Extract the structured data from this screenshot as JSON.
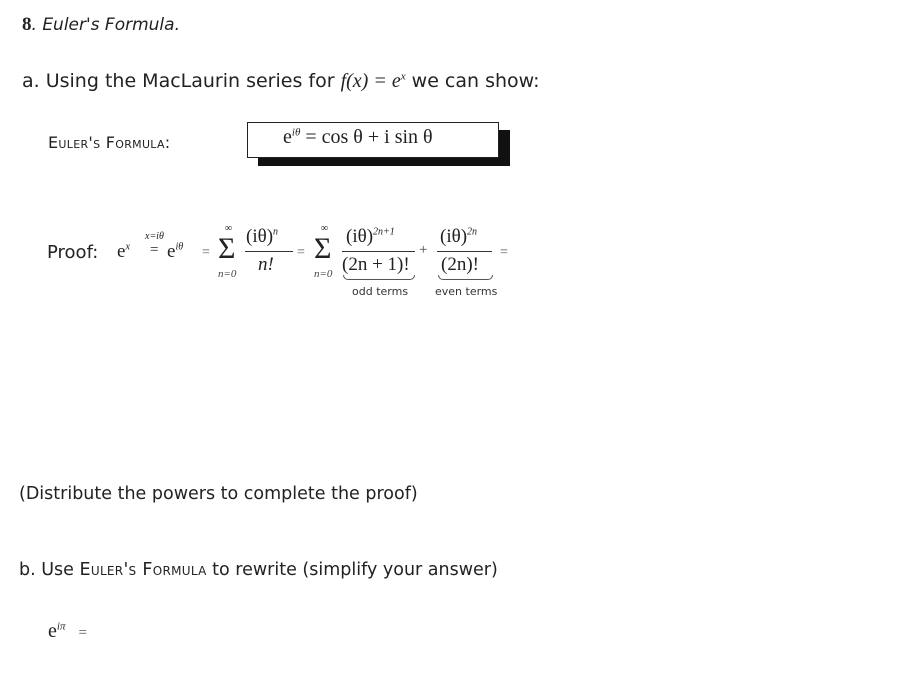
{
  "problem": {
    "number": "8",
    "title": "Euler's Formula."
  },
  "part_a": {
    "intro_prefix": "a. Using the MacLaurin series for ",
    "function": "f(x) = e",
    "function_exponent": "x",
    "intro_suffix": " we can show:",
    "euler_label": "Euler's Formula:",
    "euler_formula": {
      "lhs_base": "e",
      "lhs_exponent": "iθ",
      "rhs": "= cos θ + i sin θ"
    },
    "proof": {
      "label": "Proof:",
      "e_x_base": "e",
      "e_x_exponent": "x",
      "substitution": "x=iθ",
      "equals": "=",
      "e_itheta_base": "e",
      "e_itheta_exponent": "iθ",
      "sum1": {
        "sigma": "Σ",
        "upper": "∞",
        "lower": "n=0",
        "numerator": "(iθ)",
        "numerator_exponent": "n",
        "denominator": "n!"
      },
      "sum2": {
        "sigma": "Σ",
        "upper": "∞",
        "lower": "n=0",
        "odd_numerator": "(iθ)",
        "odd_numerator_exponent": "2n+1",
        "odd_denominator": "(2n + 1)!",
        "plus": "+",
        "even_numerator": "(iθ)",
        "even_numerator_exponent": "2n",
        "even_denominator": "(2n)!",
        "odd_label": "odd terms",
        "even_label": "even terms"
      },
      "trailing_equals": "="
    },
    "instruction": "(Distribute the powers to complete the proof)"
  },
  "part_b": {
    "prefix": "b.  Use ",
    "euler_ref": "Euler's Formula",
    "suffix": " to rewrite (simplify your answer)",
    "expression_base": "e",
    "expression_exponent": "iπ",
    "expression_equals": "="
  }
}
